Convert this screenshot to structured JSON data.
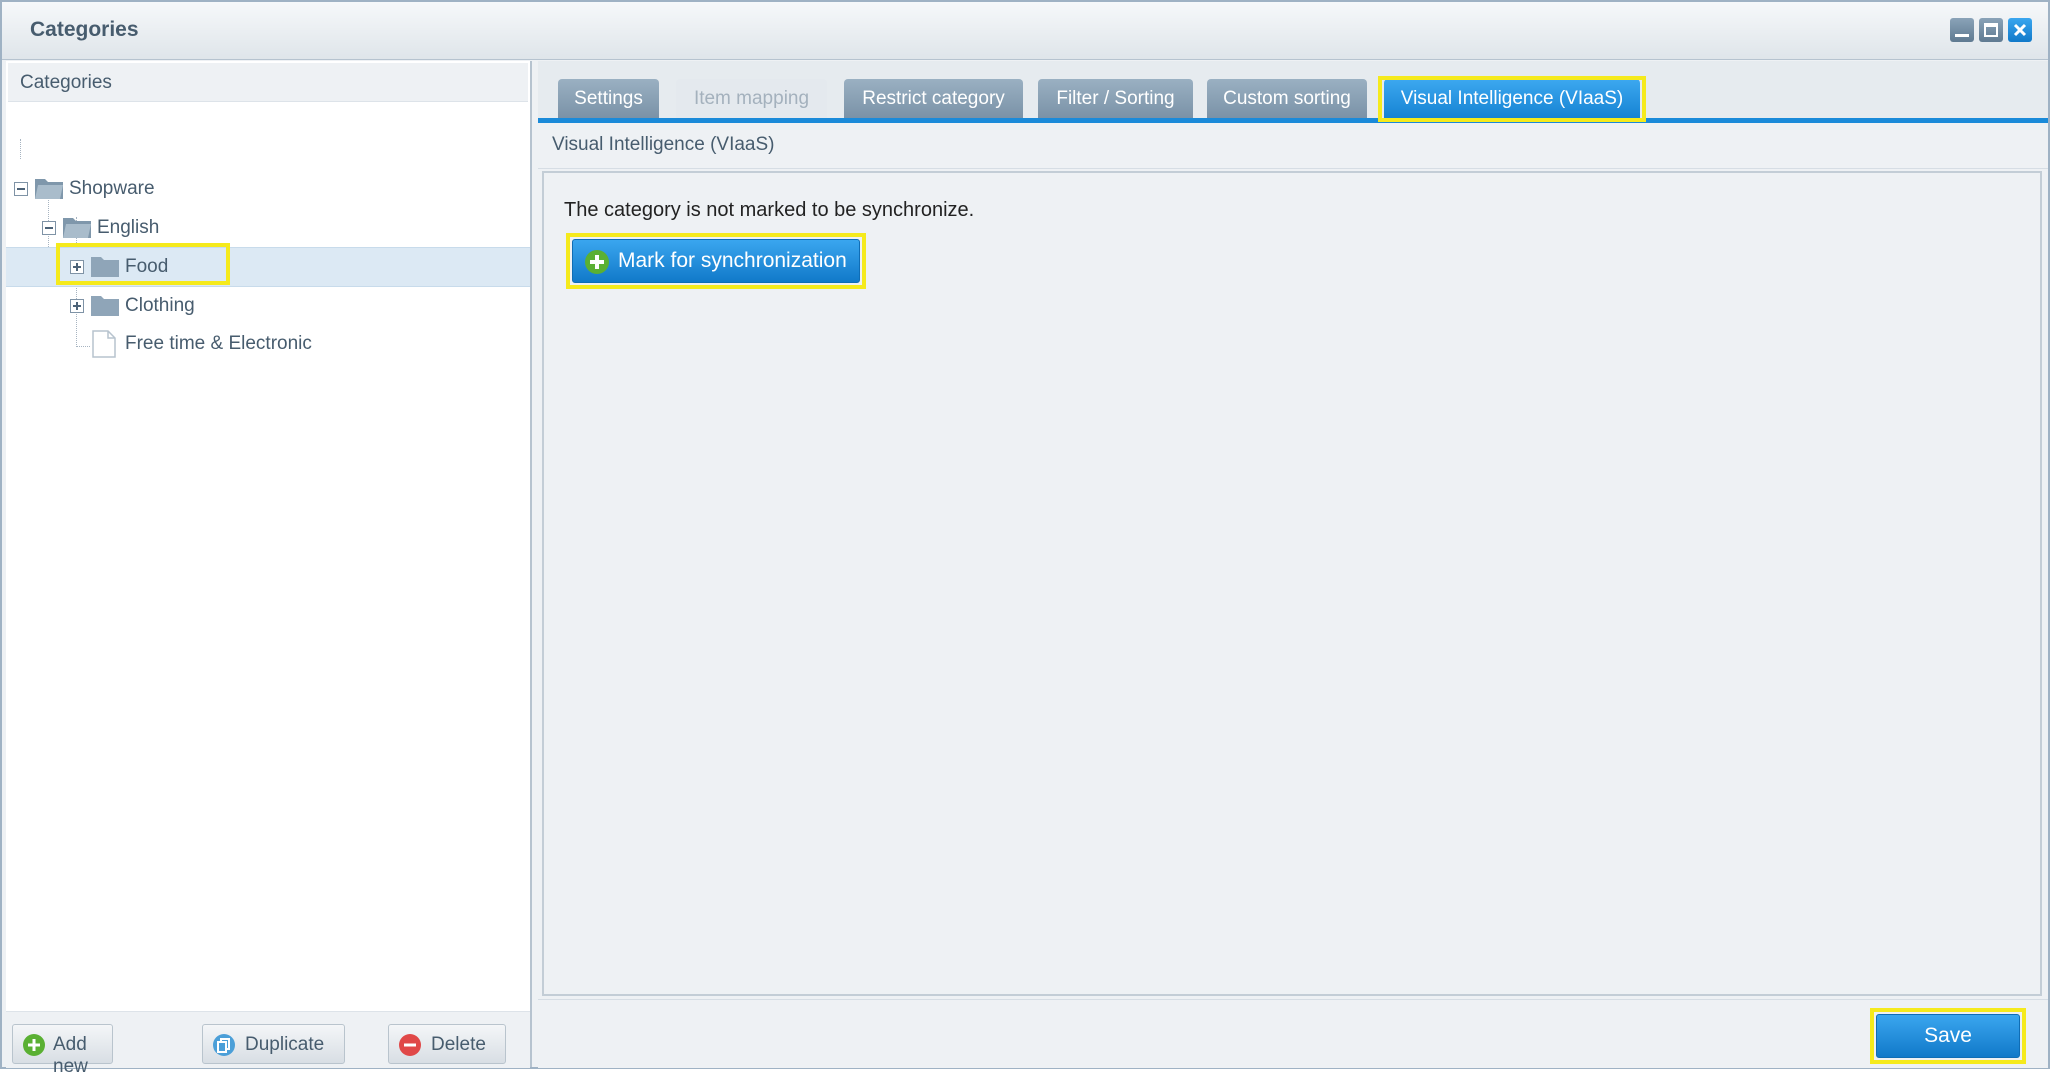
{
  "window": {
    "title": "Categories"
  },
  "tree": {
    "header": "Categories",
    "nodes": [
      {
        "label": "Shopware"
      },
      {
        "label": "English"
      },
      {
        "label": "Food"
      },
      {
        "label": "Clothing"
      },
      {
        "label": "Free time & Electronic"
      }
    ]
  },
  "left_footer": {
    "add_new": "Add new",
    "duplicate": "Duplicate",
    "delete": "Delete"
  },
  "tabs": [
    {
      "label": "Settings",
      "state": "normal"
    },
    {
      "label": "Item mapping",
      "state": "disabled"
    },
    {
      "label": "Restrict category",
      "state": "normal"
    },
    {
      "label": "Filter / Sorting",
      "state": "normal"
    },
    {
      "label": "Custom sorting",
      "state": "normal"
    },
    {
      "label": "Visual Intelligence (VIaaS)",
      "state": "active"
    }
  ],
  "panel": {
    "title": "Visual Intelligence (VIaaS)",
    "message": "The category is not marked to be synchronize.",
    "mark_button": "Mark for synchronization"
  },
  "footer": {
    "save": "Save"
  },
  "colors": {
    "accent": "#1a8ad9",
    "highlight": "#f5ea1c",
    "add_green": "#5ab033",
    "delete_red": "#e04848"
  }
}
